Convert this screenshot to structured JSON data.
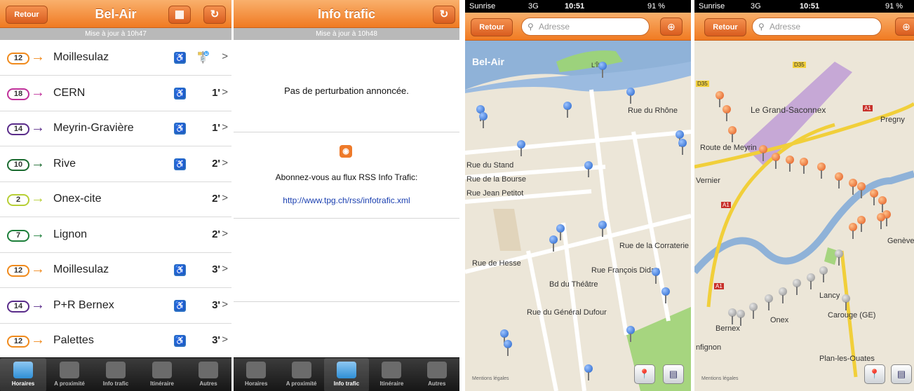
{
  "screen1": {
    "title": "Bel-Air",
    "back_label": "Retour",
    "update": "Mise à jour à 10h47",
    "rows": [
      {
        "line": "12",
        "color": "#f08a1c",
        "dest": "Moillesulaz",
        "wheelchair": true,
        "time": "",
        "bus": true
      },
      {
        "line": "18",
        "color": "#c0309a",
        "dest": "CERN",
        "wheelchair": true,
        "time": "1'"
      },
      {
        "line": "14",
        "color": "#5a2c8a",
        "dest": "Meyrin-Gravière",
        "wheelchair": true,
        "time": "1'"
      },
      {
        "line": "10",
        "color": "#1b6b30",
        "dest": "Rive",
        "wheelchair": true,
        "time": "2'"
      },
      {
        "line": "2",
        "color": "#b7cf36",
        "dest": "Onex-cite",
        "wheelchair": false,
        "time": "2'"
      },
      {
        "line": "7",
        "color": "#1d7f3a",
        "dest": "Lignon",
        "wheelchair": false,
        "time": "2'"
      },
      {
        "line": "12",
        "color": "#f08a1c",
        "dest": "Moillesulaz",
        "wheelchair": true,
        "time": "3'"
      },
      {
        "line": "14",
        "color": "#5a2c8a",
        "dest": "P+R Bernex",
        "wheelchair": true,
        "time": "3'"
      },
      {
        "line": "12",
        "color": "#f08a1c",
        "dest": "Palettes",
        "wheelchair": true,
        "time": "3'"
      }
    ],
    "chevron": ">",
    "bus_glyph": "🚏",
    "refresh_glyph": "↻",
    "map_glyph": "▦",
    "wheelchair_glyph": "♿",
    "arrow_glyph": "→"
  },
  "tabs": [
    "Horaires",
    "A proximité",
    "Info trafic",
    "Itinéraire",
    "Autres"
  ],
  "screen2": {
    "title": "Info trafic",
    "update": "Mise à jour à 10h48",
    "no_disruption": "Pas de perturbation annoncée.",
    "subscribe": "Abonnez-vous au flux RSS Info Trafic:",
    "link": "http://www.tpg.ch/rss/infotrafic.xml",
    "rss_glyph": "◉",
    "refresh_glyph": "↻"
  },
  "screen3": {
    "carrier": "Sunrise",
    "network": "3G",
    "clock": "10:51",
    "battery": "91 %",
    "back_label": "Retour",
    "search_placeholder": "Adresse",
    "labels": {
      "belair": "Bel-Air",
      "lile": "L'Île",
      "rhone": "Rue du Rhône",
      "stand": "Rue du Stand",
      "bourse": "Rue de la Bourse",
      "petitot": "Rue Jean Petitot",
      "hesse": "Rue de Hesse",
      "theatre": "Bd du Théâtre",
      "dufour": "Rue du Général Dufour",
      "diday": "Rue François Diday",
      "corraterie": "Rue de la Corraterie"
    },
    "legal": "Mentions légales"
  },
  "screen4": {
    "carrier": "Sunrise",
    "network": "3G",
    "clock": "10:51",
    "battery": "91 %",
    "back_label": "Retour",
    "search_placeholder": "Adresse",
    "labels": {
      "saconnex": "Le Grand-Saconnex",
      "pregny": "Pregny",
      "route": "Route de Meyrin",
      "vernier": "Vernier",
      "lancy": "Lancy",
      "onex": "Onex",
      "carouge": "Carouge (GE)",
      "bernex": "Bernex",
      "confignon": "nfignon",
      "plan": "Plan-les-Ouates",
      "geneve": "Genève",
      "d35": "D35",
      "d35b": "D35",
      "a1a": "A1",
      "a1b": "A1",
      "a1c": "A1"
    },
    "legal": "Mentions légales"
  }
}
